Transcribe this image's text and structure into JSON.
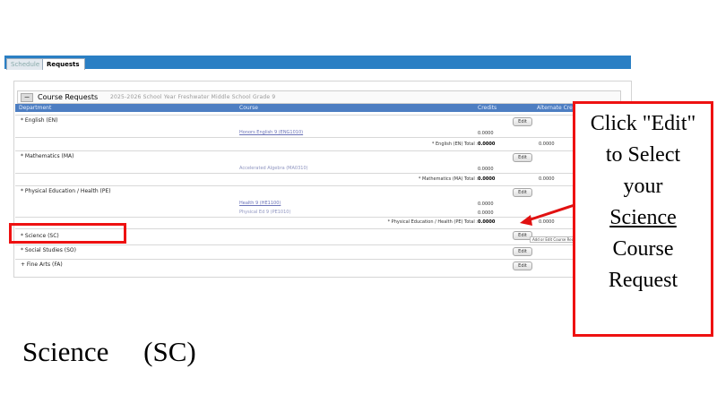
{
  "tabs": [
    {
      "label": "Schedule"
    },
    {
      "label": "Requests"
    }
  ],
  "panel": {
    "collapse_symbol": "−",
    "title": "Course Requests",
    "subtitle": "2025-2026 School Year   Freshwater Middle School   Grade 9"
  },
  "columns": {
    "department": "Department",
    "course": "Course",
    "credits": "Credits",
    "alternate": "Alternate Credits"
  },
  "rows": {
    "english": {
      "department": "* English (EN)",
      "edit": "Edit",
      "course": "Honors English 9 (ENG1010)",
      "credit": "0.0000",
      "total_label": "* English (EN) Total :",
      "total": "0.0000",
      "alt": "0.0000"
    },
    "math": {
      "department": "* Mathematics (MA)",
      "edit": "Edit",
      "course": "Accelerated Algebra (MA0310)",
      "credit": "0.0000",
      "total_label": "* Mathematics (MA) Total :",
      "total": "0.0000",
      "alt": "0.0000"
    },
    "pe": {
      "department": "* Physical Education / Health (PE)",
      "edit": "Edit",
      "course1": "Health 9 (HE1100)",
      "credit1": "0.0000",
      "course2": "Physical Ed 9 (PE1010)",
      "credit2": "0.0000",
      "total_label": "* Physical Education / Health (PE) Total :",
      "total": "0.0000",
      "alt": "0.0000"
    },
    "science": {
      "department": "* Science (SC)",
      "edit": "Edit",
      "tooltip": "Add or Edit Course Req"
    },
    "social": {
      "department": "* Social Studies (SO)",
      "edit": "Edit"
    },
    "arts": {
      "department": "+ Fine Arts (FA)",
      "edit": "Edit"
    }
  },
  "callout": {
    "line1": "Click \"Edit\"",
    "line2": "to  Select",
    "line3": "your",
    "line4": "Science",
    "line5": "Course",
    "line6": "Request"
  },
  "footer_label": "Science     (SC)",
  "colors": {
    "tab_bar": "#2a7fc4",
    "header": "#4d7ec2",
    "annotation_red": "#e11111"
  }
}
